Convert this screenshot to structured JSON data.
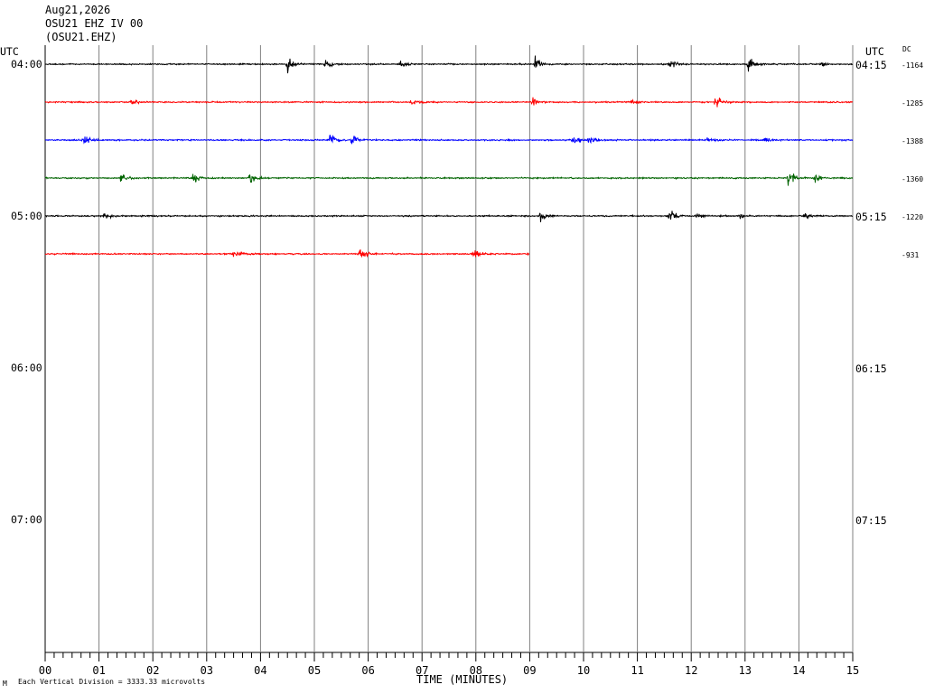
{
  "header": {
    "date": "Aug21,2026",
    "channel": "OSU21 EHZ IV 00",
    "scnl": "(OSU21.EHZ)"
  },
  "left_tz": "UTC",
  "right_tz": "UTC",
  "dc_header": "DC",
  "left_time_labels": [
    "04:00",
    "05:00",
    "06:00",
    "07:00"
  ],
  "right_time_labels": [
    "04:15",
    "05:15",
    "06:15",
    "07:15"
  ],
  "x_tick_labels": [
    "00",
    "01",
    "02",
    "03",
    "04",
    "05",
    "06",
    "07",
    "08",
    "09",
    "10",
    "11",
    "12",
    "13",
    "14",
    "15"
  ],
  "x_axis_label": "TIME (MINUTES)",
  "footer_text": "Each Vertical Division = 3333.33 microvolts",
  "corner_mark": "M",
  "dc_offsets": [
    "-1164",
    "-1285",
    "-1388",
    "-1360",
    "-1220",
    "-931"
  ],
  "colors": {
    "black": "#000000",
    "red": "#ff0000",
    "blue": "#0000ff",
    "green": "#006400",
    "grid": "#808080"
  },
  "chart_data": {
    "type": "line",
    "xlabel": "TIME (MINUTES)",
    "x_range": [
      0,
      15
    ],
    "rows_per_hour": 4,
    "row_duration_minutes": 15,
    "row_start_times": [
      "04:00",
      "04:15",
      "04:30",
      "04:45",
      "05:00",
      "05:15"
    ],
    "series": [
      {
        "color": "black",
        "start": "04:00",
        "end_minute": 15,
        "dc": -1164,
        "events": [
          [
            4.5,
            1.8
          ],
          [
            5.2,
            1.0
          ],
          [
            6.6,
            0.9
          ],
          [
            9.1,
            1.5
          ],
          [
            11.6,
            1.1
          ],
          [
            13.05,
            2.4
          ],
          [
            14.4,
            0.7
          ]
        ]
      },
      {
        "color": "red",
        "start": "04:15",
        "end_minute": 15,
        "dc": -1285,
        "events": [
          [
            1.6,
            0.8
          ],
          [
            6.8,
            1.2
          ],
          [
            9.05,
            1.3
          ],
          [
            10.9,
            0.5
          ],
          [
            12.45,
            1.4
          ]
        ]
      },
      {
        "color": "blue",
        "start": "04:30",
        "end_minute": 15,
        "dc": -1388,
        "events": [
          [
            0.7,
            1.4
          ],
          [
            5.3,
            1.5
          ],
          [
            5.7,
            1.2
          ],
          [
            9.8,
            1.6
          ],
          [
            10.1,
            1.2
          ],
          [
            12.3,
            0.8
          ],
          [
            13.35,
            0.7
          ]
        ]
      },
      {
        "color": "green",
        "start": "04:45",
        "end_minute": 15,
        "dc": -1360,
        "events": [
          [
            1.4,
            1.0
          ],
          [
            2.75,
            1.3
          ],
          [
            3.8,
            1.0
          ],
          [
            13.8,
            2.2
          ],
          [
            14.3,
            1.0
          ]
        ]
      },
      {
        "color": "black",
        "start": "05:00",
        "end_minute": 15,
        "dc": -1220,
        "events": [
          [
            1.1,
            0.8
          ],
          [
            9.2,
            1.4
          ],
          [
            11.6,
            1.4
          ],
          [
            12.1,
            0.7
          ],
          [
            12.9,
            0.6
          ],
          [
            14.1,
            0.6
          ]
        ]
      },
      {
        "color": "red",
        "start": "05:15",
        "end_minute": 9,
        "dc": -931,
        "events": [
          [
            3.5,
            1.0
          ],
          [
            5.85,
            1.2
          ],
          [
            7.95,
            1.3
          ]
        ]
      }
    ]
  }
}
